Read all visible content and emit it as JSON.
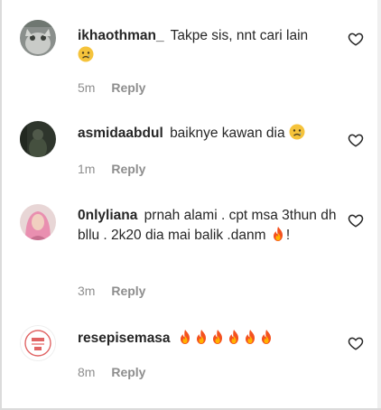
{
  "comments": [
    {
      "username": "ikhaothman_",
      "text": "Takpe sis, nnt cari lain",
      "emoji": [
        "sad-face"
      ],
      "time": "5m",
      "reply_label": "Reply"
    },
    {
      "username": "asmidaabdul",
      "text": "baiknye kawan dia",
      "emoji": [
        "sad-face"
      ],
      "time": "1m",
      "reply_label": "Reply"
    },
    {
      "username": "0nlyliana",
      "text": "prnah alami . cpt msa 3thun dh bllu . 2k20 dia mai balik .danm",
      "text_after_emoji": "!",
      "emoji": [
        "fire"
      ],
      "time": "3m",
      "reply_label": "Reply"
    },
    {
      "username": "resepisemasa",
      "text": "",
      "emoji": [
        "fire",
        "fire",
        "fire",
        "fire",
        "fire",
        "fire"
      ],
      "time": "8m",
      "reply_label": "Reply"
    }
  ],
  "icons": {
    "like": "heart-outline-icon"
  },
  "colors": {
    "text": "#262626",
    "secondary": "#8e8e8e",
    "background": "#ffffff"
  }
}
